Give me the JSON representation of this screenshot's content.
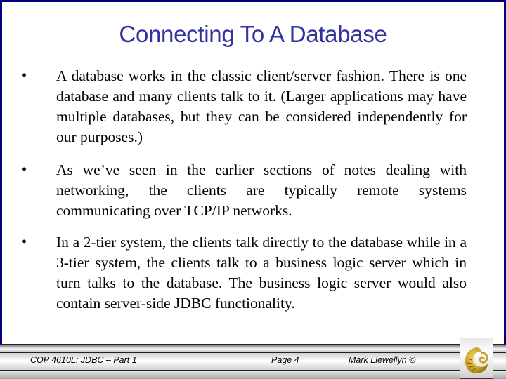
{
  "slide": {
    "title": "Connecting To A Database",
    "bullets": [
      {
        "marker": "•",
        "text": "A database works in the classic client/server fashion.  There is one database and many clients talk to it.   (Larger applications may have multiple databases, but they can be considered independently for our purposes.)"
      },
      {
        "marker": "•",
        "text": "As we’ve seen in the earlier sections of notes dealing with networking, the clients are typically remote systems communicating over TCP/IP networks."
      },
      {
        "marker": "•",
        "text": "In a 2-tier system, the clients talk directly to the database while in a 3-tier system, the clients talk to a business logic server which in turn talks to the database.  The business logic server would also contain server-side JDBC functionality."
      }
    ]
  },
  "footer": {
    "course": "COP 4610L: JDBC – Part 1",
    "page": "Page 4",
    "author": "Mark Llewellyn ©",
    "logo": "ucf-pegasus-logo"
  },
  "colors": {
    "frame": "#000080",
    "title": "#3333a0",
    "logo_gold": "#c9a227"
  }
}
